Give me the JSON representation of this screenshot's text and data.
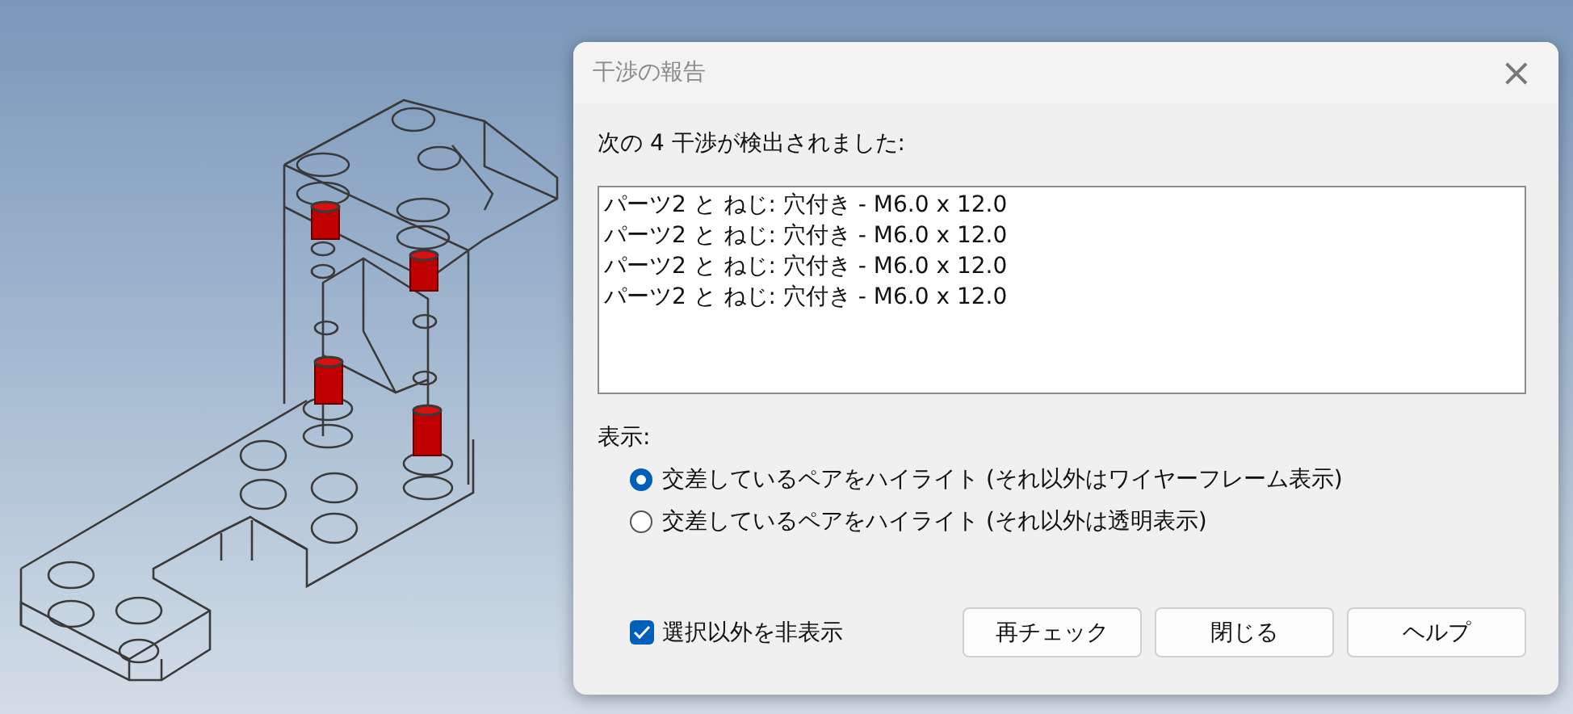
{
  "dialog": {
    "title": "干渉の報告",
    "close": "×"
  },
  "summary": "次の 4 干渉が検出されました:",
  "interferences": [
    "パーツ2 と ねじ: 穴付き - M6.0 x 12.0",
    "パーツ2 と ねじ: 穴付き - M6.0 x 12.0",
    "パーツ2 と ねじ: 穴付き - M6.0 x 12.0",
    "パーツ2 と ねじ: 穴付き - M6.0 x 12.0"
  ],
  "display_label": "表示:",
  "display_options": [
    {
      "label": "交差しているペアをハイライト (それ以外はワイヤーフレーム表示)",
      "selected": true
    },
    {
      "label": "交差しているペアをハイライト (それ以外は透明表示)",
      "selected": false
    }
  ],
  "hide_others": {
    "label": "選択以外を非表示",
    "checked": true
  },
  "buttons": [
    "再チェック",
    "閉じる",
    "ヘルプ"
  ]
}
